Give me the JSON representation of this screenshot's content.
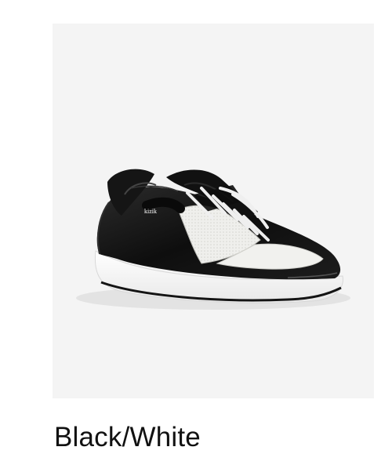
{
  "product": {
    "color_name": "Black/White",
    "shoe_brand_mark": "kizik",
    "image_background": "#f4f4f4",
    "upper_color": "#111111",
    "panel_color": "#f1f1ee",
    "sole_color": "#ffffff"
  }
}
